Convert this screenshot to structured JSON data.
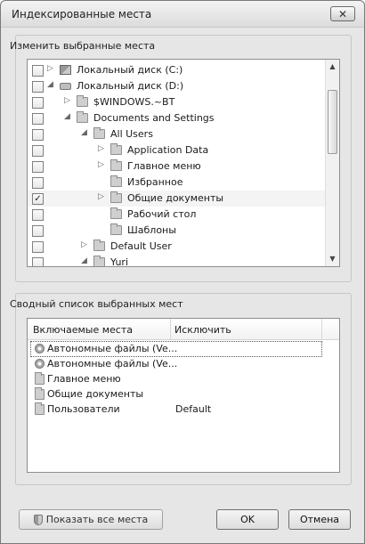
{
  "window": {
    "title": "Индексированные места",
    "close_glyph": "✕"
  },
  "change_group": {
    "label": "Изменить выбранные места"
  },
  "tree": [
    {
      "label": "Локальный диск (C:)",
      "checked": false,
      "expander": "▷",
      "icon": "system-drive-icon"
    },
    {
      "label": "Локальный диск (D:)",
      "checked": false,
      "expander": "◢",
      "icon": "drive-icon"
    },
    {
      "label": "$WINDOWS.~BT",
      "checked": false,
      "expander": "▷",
      "icon": "folder-icon"
    },
    {
      "label": "Documents and Settings",
      "checked": false,
      "expander": "◢",
      "icon": "folder-icon"
    },
    {
      "label": "All Users",
      "checked": false,
      "expander": "◢",
      "icon": "folder-icon"
    },
    {
      "label": "Application Data",
      "checked": false,
      "expander": "▷",
      "icon": "folder-icon"
    },
    {
      "label": "Главное меню",
      "checked": false,
      "expander": "▷",
      "icon": "folder-icon"
    },
    {
      "label": "Избранное",
      "checked": false,
      "expander": "",
      "icon": "folder-icon"
    },
    {
      "label": "Общие документы",
      "checked": true,
      "check_glyph": "✓",
      "expander": "▷",
      "icon": "folder-icon"
    },
    {
      "label": "Рабочий стол",
      "checked": false,
      "expander": "",
      "icon": "folder-icon"
    },
    {
      "label": "Шаблоны",
      "checked": false,
      "expander": "",
      "icon": "folder-icon"
    },
    {
      "label": "Default User",
      "checked": false,
      "expander": "▷",
      "icon": "folder-icon"
    },
    {
      "label": "Yuri",
      "checked": false,
      "expander": "◢",
      "icon": "folder-icon"
    }
  ],
  "scroll": {
    "up_glyph": "▲",
    "down_glyph": "▼"
  },
  "summary_group": {
    "label": "Сводный список выбранных мест"
  },
  "summary_table": {
    "columns": [
      "Включаемые места",
      "Исключить"
    ],
    "rows": [
      {
        "name": "Автономные файлы (Ve...",
        "exclude": "",
        "icon": "offline-files-icon"
      },
      {
        "name": "Автономные файлы (Ve...",
        "exclude": "",
        "icon": "offline-files-icon"
      },
      {
        "name": "Главное меню",
        "exclude": "",
        "icon": "folder-icon"
      },
      {
        "name": "Общие документы",
        "exclude": "",
        "icon": "folder-icon"
      },
      {
        "name": "Пользователи",
        "exclude": "Default",
        "icon": "folder-icon"
      }
    ]
  },
  "buttons": {
    "show_all": "Показать все места",
    "ok": "OK",
    "cancel": "Отмена"
  }
}
